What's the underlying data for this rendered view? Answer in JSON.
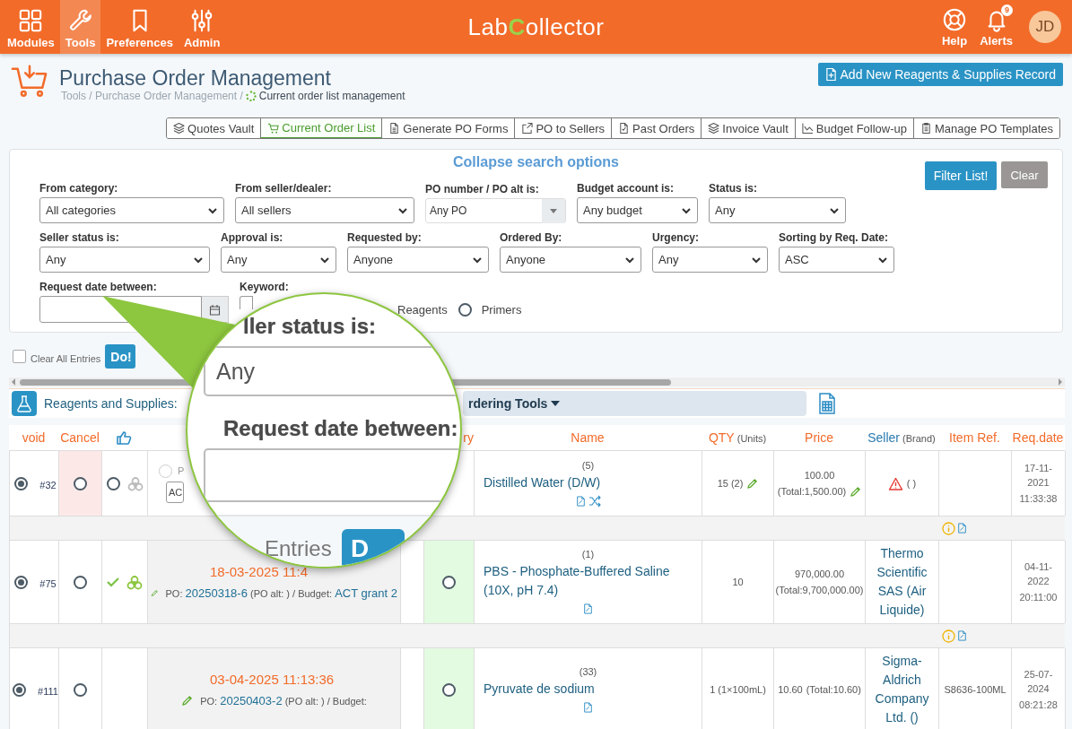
{
  "topbar": {
    "nav": [
      {
        "label": "Modules",
        "selected": false
      },
      {
        "label": "Tools",
        "selected": true
      },
      {
        "label": "Preferences",
        "selected": false
      },
      {
        "label": "Admin",
        "selected": false
      }
    ],
    "logo": {
      "lead": "Lab",
      "accent": "C",
      "rest": "ollector"
    },
    "actions": [
      {
        "label": "Help",
        "kind": "help"
      },
      {
        "label": "Alerts",
        "kind": "alerts",
        "badge": "9"
      }
    ],
    "avatar": "JD"
  },
  "header": {
    "title": "Purchase Order Management",
    "breadcrumb": "Tools / Purchase Order Management /",
    "current": "Current order list management",
    "add_button": "Add New Reagents & Supplies Record"
  },
  "tabs": [
    {
      "label": "Quotes Vault",
      "selected": false
    },
    {
      "label": "Current Order List",
      "selected": true
    },
    {
      "label": "Generate PO Forms",
      "selected": false
    },
    {
      "label": "PO to Sellers",
      "selected": false
    },
    {
      "label": "Past Orders",
      "selected": false
    },
    {
      "label": "Invoice Vault",
      "selected": false
    },
    {
      "label": "Budget Follow-up",
      "selected": false
    },
    {
      "label": "Manage PO Templates",
      "selected": false
    }
  ],
  "search": {
    "title": "Collapse search options",
    "buttons": [
      {
        "label": "Filter List!",
        "kind": "primary"
      },
      {
        "label": "Clear",
        "kind": "secondary"
      }
    ],
    "rows": [
      [
        {
          "label": "From category:",
          "kind": "select",
          "value": "All categories"
        },
        {
          "label": "From seller/dealer:",
          "kind": "select",
          "value": "All sellers"
        },
        {
          "label": "PO number / PO alt is:",
          "kind": "combo",
          "value": "Any PO"
        },
        {
          "label": "Budget account is:",
          "kind": "select",
          "value": "Any budget"
        },
        {
          "label": "Status is:",
          "kind": "select",
          "value": "Any"
        }
      ],
      [
        {
          "label": "Seller status is:",
          "kind": "select",
          "value": "Any"
        },
        {
          "label": "Approval is:",
          "kind": "select",
          "value": "Any"
        },
        {
          "label": "Requested by:",
          "kind": "select",
          "value": "Anyone"
        },
        {
          "label": "Ordered By:",
          "kind": "select",
          "value": "Anyone"
        },
        {
          "label": "Urgency:",
          "kind": "select",
          "value": "Any"
        },
        {
          "label": "Sorting by Req. Date:",
          "kind": "select",
          "value": "ASC"
        }
      ],
      [
        {
          "label": "Request date between:",
          "kind": "date"
        },
        {
          "label": "Keyword:",
          "kind": "text"
        },
        {
          "kind": "radios",
          "options": [
            {
              "label": "Reagents"
            },
            {
              "label": "Primers",
              "selected": false
            }
          ]
        }
      ]
    ]
  },
  "bulk": {
    "label": "Clear All Entries",
    "checked": false,
    "button": "Do!"
  },
  "table": {
    "title": "Reagents and Supplies:",
    "tools_button": "rdering Tools",
    "columns": [
      {
        "kind": "text",
        "label": "void",
        "sorted": false
      },
      {
        "kind": "text",
        "label": "Cancel",
        "sorted": false
      },
      {
        "kind": "icon"
      },
      {
        "kind": "blank"
      },
      {
        "kind": "blank"
      },
      {
        "kind": "text",
        "label": "ry",
        "sorted": false
      },
      {
        "kind": "text",
        "label": "Name",
        "sorted": false
      },
      {
        "kind": "text",
        "label": "QTY",
        "unit": "(Units)",
        "sorted": false
      },
      {
        "kind": "text",
        "label": "Price",
        "sorted": false
      },
      {
        "kind": "text",
        "label": "Seller",
        "unit": "(Brand)",
        "sorted": true
      },
      {
        "kind": "text",
        "label": "Item Ref.",
        "sorted": false
      },
      {
        "kind": "text",
        "label": "Req.date",
        "sorted": false
      }
    ],
    "rows": [
      {
        "selected": true,
        "id": "#32",
        "cancel_highlighted": true,
        "cancelled": false,
        "approval_open": true,
        "approved": false,
        "biohazard": true,
        "order": {
          "kind": "draft",
          "checked": false,
          "label": "P",
          "select": "AC"
        },
        "delivery": false,
        "count": "(5)",
        "name": "Distilled Water (D/W)",
        "shuffle": true,
        "qty": "15 (2)",
        "qty_editable": true,
        "price": "100.00",
        "total": "(Total:1,500.00)",
        "price_editable": true,
        "seller_warning": true,
        "seller": "( )",
        "date": "17-11-2021",
        "time": "11:33:38",
        "note": true
      },
      {
        "selected": true,
        "id": "#75",
        "cancel_highlighted": false,
        "cancelled": false,
        "approval_open": false,
        "approved": true,
        "biohazard": true,
        "order": {
          "kind": "ordered",
          "date": "18-03-2025 11:4",
          "po_label": "PO:",
          "po": "20250318-6",
          "po_alt": "(PO alt: )",
          "budget_label": "/ Budget:",
          "budget": "ACT grant 2"
        },
        "delivery": true,
        "received": false,
        "count": "(1)",
        "name": "PBS - Phosphate-Buffered Saline (10X, pH 7.4)",
        "shuffle": false,
        "qty": "10",
        "qty_editable": false,
        "price": "970,000.00",
        "total": "(Total:9,700,000.00)",
        "price_editable": false,
        "seller_warning": false,
        "seller": "Thermo Scientific SAS (Air Liquide)",
        "date": "04-11-2022",
        "time": "20:11:00",
        "note": true
      },
      {
        "selected": true,
        "id": "#111",
        "cancel_highlighted": false,
        "cancelled": false,
        "approval_open": false,
        "approved": false,
        "biohazard": false,
        "order": {
          "kind": "ordered",
          "date": "03-04-2025 11:13:36",
          "po_label": "PO:",
          "po": "20250403-2",
          "po_alt": "(PO alt: )",
          "budget_label": "/ Budget:"
        },
        "delivery": true,
        "received": false,
        "count": "(33)",
        "name": "Pyruvate de sodium",
        "shuffle": false,
        "qty": "1 (1×100mL)",
        "qty_editable": false,
        "price": "10.60",
        "total": "(Total:10.60)",
        "price_editable": false,
        "seller_warning": false,
        "seller": "Sigma-Aldrich Company Ltd. ()",
        "item_ref": "S8636-100ML",
        "date": "25-07-2024",
        "time": "08:21:28",
        "note": false
      }
    ]
  },
  "callout": {
    "status_label": "ller status is:",
    "status_value": "Any",
    "date_label": "Request date between:",
    "bulk_label": "Entries",
    "bulk_button": "D"
  }
}
